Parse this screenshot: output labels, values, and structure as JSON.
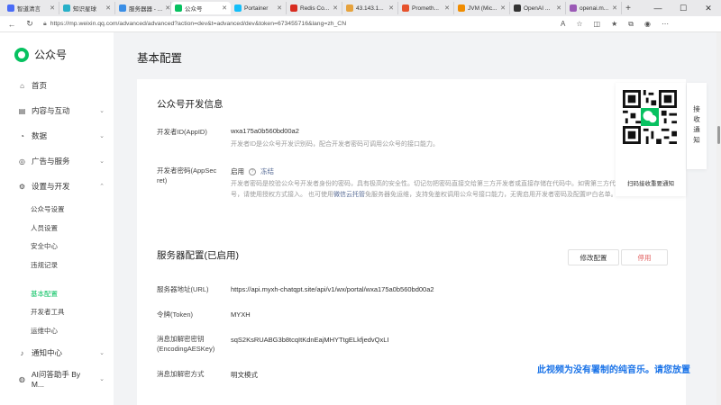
{
  "browser": {
    "tabs": [
      {
        "title": "智道清言",
        "color": "#4a6cf7"
      },
      {
        "title": "知识星球",
        "color": "#27b0c8"
      },
      {
        "title": "服务器器 - ...",
        "color": "#3a8ee6"
      },
      {
        "title": "公众号",
        "color": "#07c160",
        "active": true
      },
      {
        "title": "Portainer",
        "color": "#13bef9"
      },
      {
        "title": "Redis Co...",
        "color": "#d82c20"
      },
      {
        "title": "43.143.1...",
        "color": "#e6a23c"
      },
      {
        "title": "Prometh...",
        "color": "#e6522c"
      },
      {
        "title": "JVM (Mic...",
        "color": "#f08c00"
      },
      {
        "title": "OpenAI ...",
        "color": "#333333"
      },
      {
        "title": "openai.m...",
        "color": "#9b59b6"
      }
    ],
    "url": "https://mp.weixin.qq.com/advanced/advanced?action=dev&t=advanced/dev&token=673455716&lang=zh_CN"
  },
  "sidebar": {
    "logo": "公众号",
    "items": {
      "home": "首页",
      "content": "内容与互动",
      "data": "数据",
      "ads": "广告与服务",
      "settings": "设置与开发",
      "notify": "通知中心",
      "ai": "AI问答助手 By M..."
    },
    "settings_sub": {
      "account": "公众号设置",
      "people": "人员设置",
      "security": "安全中心",
      "violation": "违规记录"
    },
    "dev_sub": {
      "basic": "基本配置",
      "tools": "开发者工具",
      "ops": "运维中心"
    }
  },
  "page_title": "基本配置",
  "dev_info": {
    "title": "公众号开发信息",
    "appid_label": "开发者ID(AppID)",
    "appid_value": "wxa175a0b560bd00a2",
    "appid_desc": "开发者ID是公众号开发识别码，配合开发者密码可调用公众号的接口能力。",
    "secret_label_1": "开发者密码(AppSec",
    "secret_label_2": "ret)",
    "secret_enabled": "启用",
    "secret_freeze": "冻结",
    "secret_desc_1": "开发者密码是校验公众号开发者身份的密码，具有极高的安全性。切记勿把密码直接交给第三方开发者或直接存储在代码中。如需第三方代开发公众",
    "secret_desc_2a": "号，请使用授权方式接入。 也可使用",
    "secret_desc_link": "微信云托管",
    "secret_desc_2b": "免服务器免运维，支持免鉴权调用公众号接口能力，无需启用开发者密码及配置IP白名单。"
  },
  "server_config": {
    "title": "服务器配置(已启用)",
    "edit_btn": "修改配置",
    "disable_btn": "停用",
    "url_label": "服务器地址(URL)",
    "url_value": "https://api.myxh-chatqpt.site/api/v1/wx/portal/wxa175a0b560bd00a2",
    "token_label": "令牌(Token)",
    "token_value": "MYXH",
    "aes_label_1": "消息加解密密钥",
    "aes_label_2": "(EncodingAESKey)",
    "aes_value": "sqS2KsRUABG3b8tcqItKdnEajMHYTtgELkfjedvQxLI",
    "mode_label": "消息加解密方式",
    "mode_value": "明文模式"
  },
  "qr": {
    "caption": "扫码接收重要通知",
    "side_tab": "接收通知"
  },
  "subtitle": "此视频为没有署制的纯音乐。请您放置"
}
